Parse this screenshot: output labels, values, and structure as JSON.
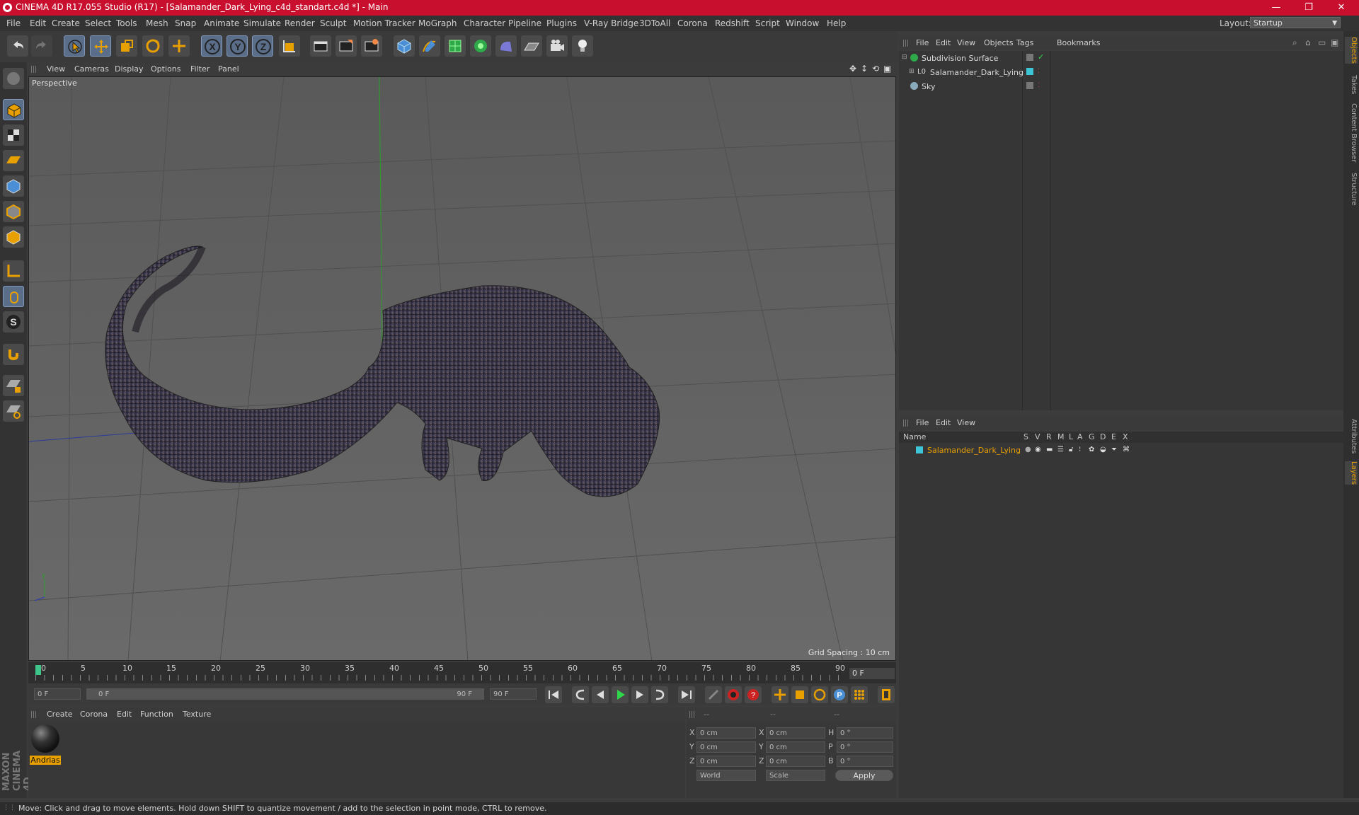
{
  "window": {
    "title": "CINEMA 4D R17.055 Studio (R17) - [Salamander_Dark_Lying_c4d_standart.c4d *] - Main",
    "controls": [
      "—",
      "❐",
      "✕"
    ]
  },
  "menubar": {
    "items": [
      "File",
      "Edit",
      "Create",
      "Select",
      "Tools",
      "Mesh",
      "Snap",
      "Animate",
      "Simulate",
      "Render",
      "Sculpt",
      "Motion Tracker",
      "MoGraph",
      "Character",
      "Pipeline",
      "Plugins",
      "V-Ray Bridge",
      "3DToAll",
      "Corona",
      "Redshift",
      "Script",
      "Window",
      "Help"
    ],
    "layout_label": "Layout:",
    "layout_value": "Startup"
  },
  "toolbar": {
    "icons": [
      "undo-icon",
      "redo-icon",
      "select-cursor-icon",
      "move-icon",
      "scale-icon",
      "rotate-icon",
      "move-all-icon",
      "x-axis-icon",
      "y-axis-icon",
      "z-axis-icon",
      "coordinate-system-icon",
      "render-view-icon",
      "render-picture-viewer-icon",
      "render-settings-icon",
      "cube-primitive-icon",
      "pen-spline-icon",
      "subdivision-icon",
      "mograph-cloner-icon",
      "deformer-icon",
      "floor-icon",
      "camera-icon",
      "light-icon"
    ],
    "axis_labels": [
      "X",
      "Y",
      "Z"
    ]
  },
  "viewport": {
    "menu": [
      "View",
      "Cameras",
      "Display",
      "Options",
      "Filter",
      "Panel"
    ],
    "label": "Perspective",
    "grid_spacing": "Grid Spacing : 10 cm"
  },
  "timeline": {
    "ticks": [
      "0",
      "5",
      "10",
      "15",
      "20",
      "25",
      "30",
      "35",
      "40",
      "45",
      "50",
      "55",
      "60",
      "65",
      "70",
      "75",
      "80",
      "85",
      "90"
    ],
    "current_frame": "0 F",
    "start_field": "0 F",
    "range_start": "0 F",
    "range_end": "90 F",
    "end_field": "90 F"
  },
  "material_manager": {
    "menu": [
      "Create",
      "Corona",
      "Edit",
      "Function",
      "Texture"
    ],
    "material_name": "Andrias"
  },
  "coordinates": {
    "headers": [
      "--",
      "--",
      "--"
    ],
    "rows": [
      {
        "axis": "X",
        "pos": "0 cm",
        "axis2": "X",
        "size": "0 cm",
        "rlabel": "H",
        "rot": "0 °"
      },
      {
        "axis": "Y",
        "pos": "0 cm",
        "axis2": "Y",
        "size": "0 cm",
        "rlabel": "P",
        "rot": "0 °"
      },
      {
        "axis": "Z",
        "pos": "0 cm",
        "axis2": "Z",
        "size": "0 cm",
        "rlabel": "B",
        "rot": "0 °"
      }
    ],
    "mode1": "World",
    "mode2": "Scale",
    "apply_label": "Apply"
  },
  "object_manager": {
    "menu": [
      "File",
      "Edit",
      "View",
      "Objects",
      "Tags",
      "Bookmarks"
    ],
    "objects": [
      {
        "name": "Subdivision Surface",
        "indent": 0
      },
      {
        "name": "Salamander_Dark_Lying",
        "indent": 1
      },
      {
        "name": "Sky",
        "indent": 0
      }
    ]
  },
  "layer_manager": {
    "menu": [
      "File",
      "Edit",
      "View"
    ],
    "header_name": "Name",
    "columns": [
      "S",
      "V",
      "R",
      "M",
      "L",
      "A",
      "G",
      "D",
      "E",
      "X"
    ],
    "layers": [
      {
        "name": "Salamander_Dark_Lying",
        "color": "#3ec6d8"
      }
    ]
  },
  "right_tabs": [
    "Objects",
    "Takes",
    "Content Browser",
    "Structure",
    "Attributes",
    "Layers"
  ],
  "brand": "MAXON CINEMA 4D",
  "status": "Move: Click and drag to move elements. Hold down SHIFT to quantize movement / add to the selection in point mode, CTRL to remove.",
  "colors": {
    "title_bar": "#c8102e",
    "accent_orange": "#e8a000",
    "active_button": "#5a6e8a",
    "layer_color": "#3ec6d8"
  }
}
